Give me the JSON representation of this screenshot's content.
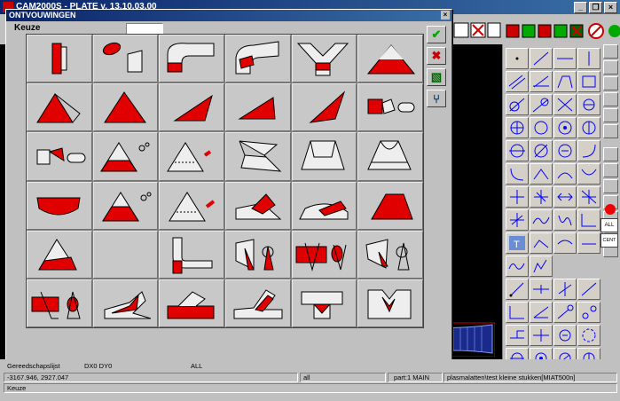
{
  "app": {
    "title": "CAM2000S - PLATE   v. 13.10.03.00",
    "window_controls": [
      "_",
      "❒",
      "×"
    ]
  },
  "dialog": {
    "title": "ONTVOUWINGEN",
    "close": "×",
    "keuze_label": "Keuze",
    "keuze_value": "",
    "side_buttons": [
      {
        "name": "confirm-icon",
        "glyph": "✔"
      },
      {
        "name": "cancel-icon",
        "glyph": "✖"
      },
      {
        "name": "shape-icon",
        "glyph": "▧"
      },
      {
        "name": "branch-icon",
        "glyph": "⑂"
      }
    ],
    "shapes": [
      "plate-cylinder",
      "ellipse-plate",
      "pipe-bend",
      "pipe-bend-cut",
      "y-branch",
      "cone",
      "pyramid",
      "pyramid-outline",
      "wedge",
      "wedge-flat",
      "wedge-slim",
      "pipe-flange",
      "pipe-joint",
      "cone-pipe",
      "cone-pipe-outline",
      "twisted-duct",
      "transition-box",
      "transition-round",
      "half-round",
      "cone-half",
      "cone-dashed",
      "wedge-cut",
      "wedge-slope",
      "polygon",
      "cone-segment",
      "empty",
      "elbow-pipe",
      "cone-intersect",
      "box-intersect",
      "cone-intersect-2",
      "tube-saddle",
      "plate-skew",
      "plate-saddle",
      "plate-notch",
      "pipe-tee",
      "pipe-y"
    ]
  },
  "status": {
    "row1": {
      "label": "Gereedschapslijst",
      "dx": "DX0 DY0",
      "mode": "ALL"
    },
    "row2": {
      "coords": "-3167.946,  2927.047",
      "layer": "all",
      "part": "part:1 MAIN",
      "path": "plasmalatten\\test kleine stukken[MIAT500n]"
    },
    "row3": {
      "prompt": "Keuze"
    }
  },
  "right_labels": {
    "all": "ALL",
    "cent": "CENT"
  },
  "colors": {
    "accent": "#ff0000",
    "titlebar": "#0a246a",
    "canvas": "#000000"
  }
}
